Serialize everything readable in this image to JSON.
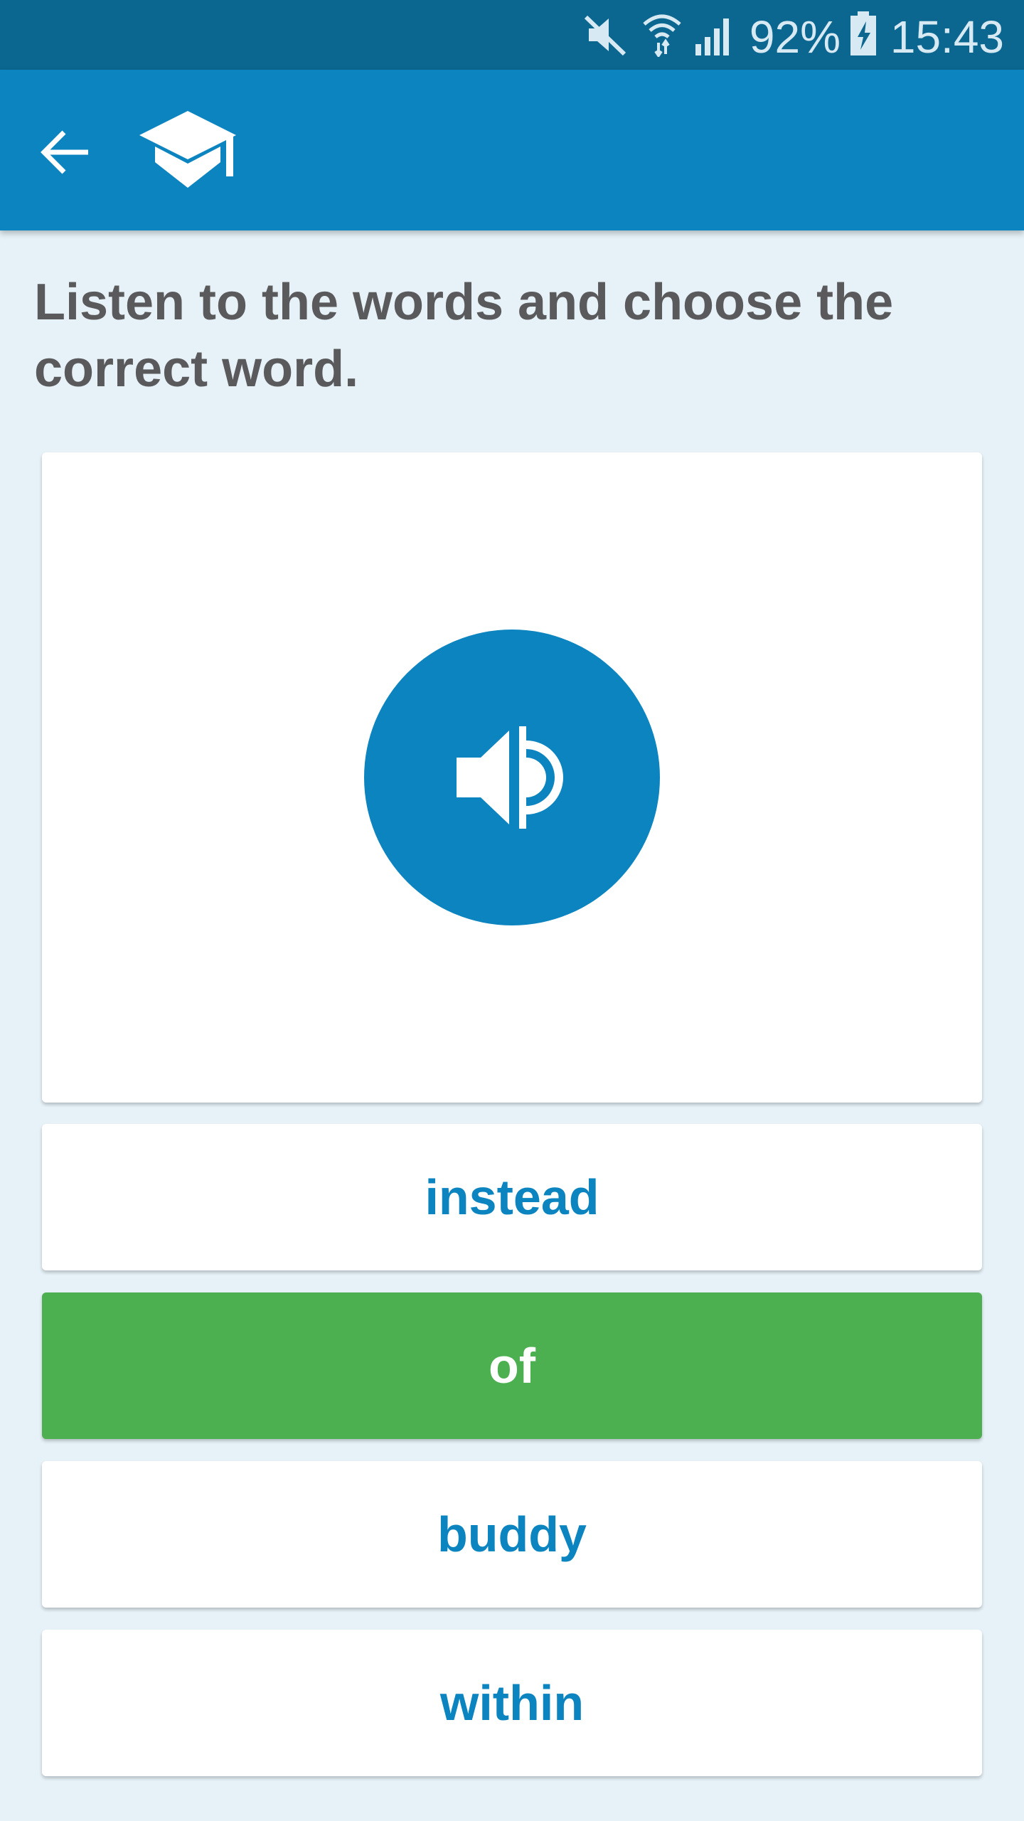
{
  "status_bar": {
    "battery_percent": "92%",
    "time": "15:43",
    "icons": [
      "mute-icon",
      "wifi-icon",
      "signal-icon",
      "battery-charging-icon"
    ]
  },
  "app_bar": {
    "back_icon": "arrow-left-icon",
    "logo_icon": "graduation-cap-icon",
    "color": "#0b84bf"
  },
  "exercise": {
    "instruction": "Listen to the words and choose the correct word.",
    "audio_icon": "speaker-icon",
    "options": [
      {
        "label": "instead",
        "state": "default"
      },
      {
        "label": "of",
        "state": "correct"
      },
      {
        "label": "buddy",
        "state": "default"
      },
      {
        "label": "within",
        "state": "default"
      }
    ]
  },
  "colors": {
    "accent": "#0b84bf",
    "correct": "#4caf50",
    "background": "#e6f2f8",
    "status_bar": "#0b6790"
  }
}
